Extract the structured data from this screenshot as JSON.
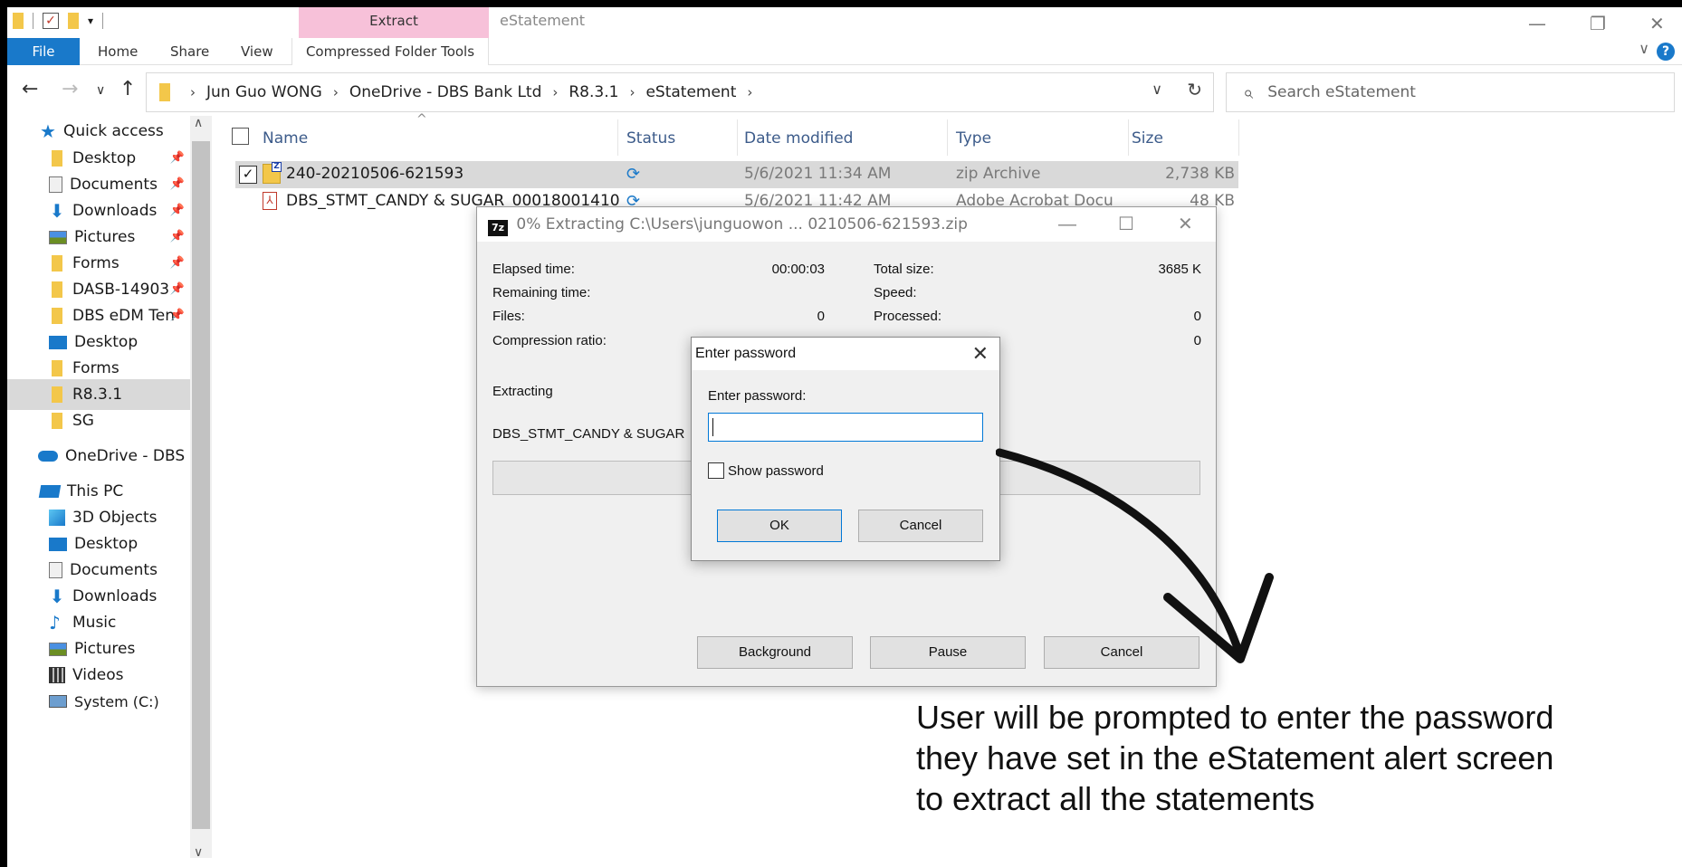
{
  "window": {
    "title": "eStatement",
    "context_tab": "Extract",
    "controls": {
      "minimize": "—",
      "restore": "❐",
      "close": "✕"
    }
  },
  "ribbon": {
    "tabs": [
      "File",
      "Home",
      "Share",
      "View"
    ],
    "context_tab": "Compressed Folder Tools",
    "help": "?"
  },
  "address": {
    "breadcrumbs": [
      "Jun Guo WONG",
      "OneDrive - DBS Bank Ltd",
      "R8.3.1",
      "eStatement"
    ],
    "search_placeholder": "Search eStatement"
  },
  "nav": {
    "items": [
      {
        "label": "Quick access",
        "icon": "star-icon"
      },
      {
        "label": "Desktop",
        "icon": "folder-icon",
        "pinned": true
      },
      {
        "label": "Documents",
        "icon": "documents-icon",
        "pinned": true
      },
      {
        "label": "Downloads",
        "icon": "download-icon",
        "pinned": true
      },
      {
        "label": "Pictures",
        "icon": "pictures-icon",
        "pinned": true
      },
      {
        "label": "Forms",
        "icon": "folder-icon",
        "pinned": true
      },
      {
        "label": "DASB-14903",
        "icon": "folder-icon",
        "pinned": true
      },
      {
        "label": "DBS eDM Ten",
        "icon": "folder-icon",
        "pinned": true
      },
      {
        "label": "Desktop",
        "icon": "desktop-icon"
      },
      {
        "label": "Forms",
        "icon": "folder-icon"
      },
      {
        "label": "R8.3.1",
        "icon": "folder-icon",
        "selected": true
      },
      {
        "label": "SG",
        "icon": "folder-icon"
      },
      {
        "label": "OneDrive - DBS Ba",
        "icon": "onedrive-icon"
      },
      {
        "label": "This PC",
        "icon": "pc-icon"
      },
      {
        "label": "3D Objects",
        "icon": "3d-objects-icon"
      },
      {
        "label": "Desktop",
        "icon": "desktop-icon"
      },
      {
        "label": "Documents",
        "icon": "documents-icon"
      },
      {
        "label": "Downloads",
        "icon": "download-icon"
      },
      {
        "label": "Music",
        "icon": "music-icon"
      },
      {
        "label": "Pictures",
        "icon": "pictures-icon"
      },
      {
        "label": "Videos",
        "icon": "videos-icon"
      },
      {
        "label": "System (C:)",
        "icon": "drive-icon"
      }
    ]
  },
  "files": {
    "columns": [
      "Name",
      "Status",
      "Date modified",
      "Type",
      "Size"
    ],
    "rows": [
      {
        "name": "240-20210506-621593",
        "status": "sync",
        "date": "5/6/2021 11:34 AM",
        "type": "zip Archive",
        "size": "2,738 KB",
        "selected": true
      },
      {
        "name": "DBS_STMT_CANDY & SUGAR_00018001410",
        "status": "sync",
        "date": "5/6/2021 11:42 AM",
        "type": "Adobe Acrobat Docu",
        "size": "48 KB"
      }
    ]
  },
  "extract_dialog": {
    "logo": "7z",
    "title": "0% Extracting C:\\Users\\junguowon ... 0210506-621593.zip",
    "elapsed_label": "Elapsed time:",
    "elapsed_value": "00:00:03",
    "remaining_label": "Remaining time:",
    "files_label": "Files:",
    "files_value": "0",
    "ratio_label": "Compression ratio:",
    "total_label": "Total size:",
    "total_value": "3685 K",
    "speed_label": "Speed:",
    "processed_label": "Processed:",
    "processed_value": "0",
    "compressed_value": "0",
    "status": "Extracting",
    "current_file": "DBS_STMT_CANDY & SUGAR",
    "progress": 0,
    "buttons": {
      "background": "Background",
      "pause": "Pause",
      "cancel": "Cancel"
    }
  },
  "password_dialog": {
    "title": "Enter password",
    "label": "Enter password:",
    "value": "",
    "show_password": "Show password",
    "ok": "OK",
    "cancel": "Cancel"
  },
  "annotation": {
    "line1": "User will be prompted to enter the password",
    "line2": "they have set in the eStatement alert screen",
    "line3": "to extract all the statements"
  }
}
